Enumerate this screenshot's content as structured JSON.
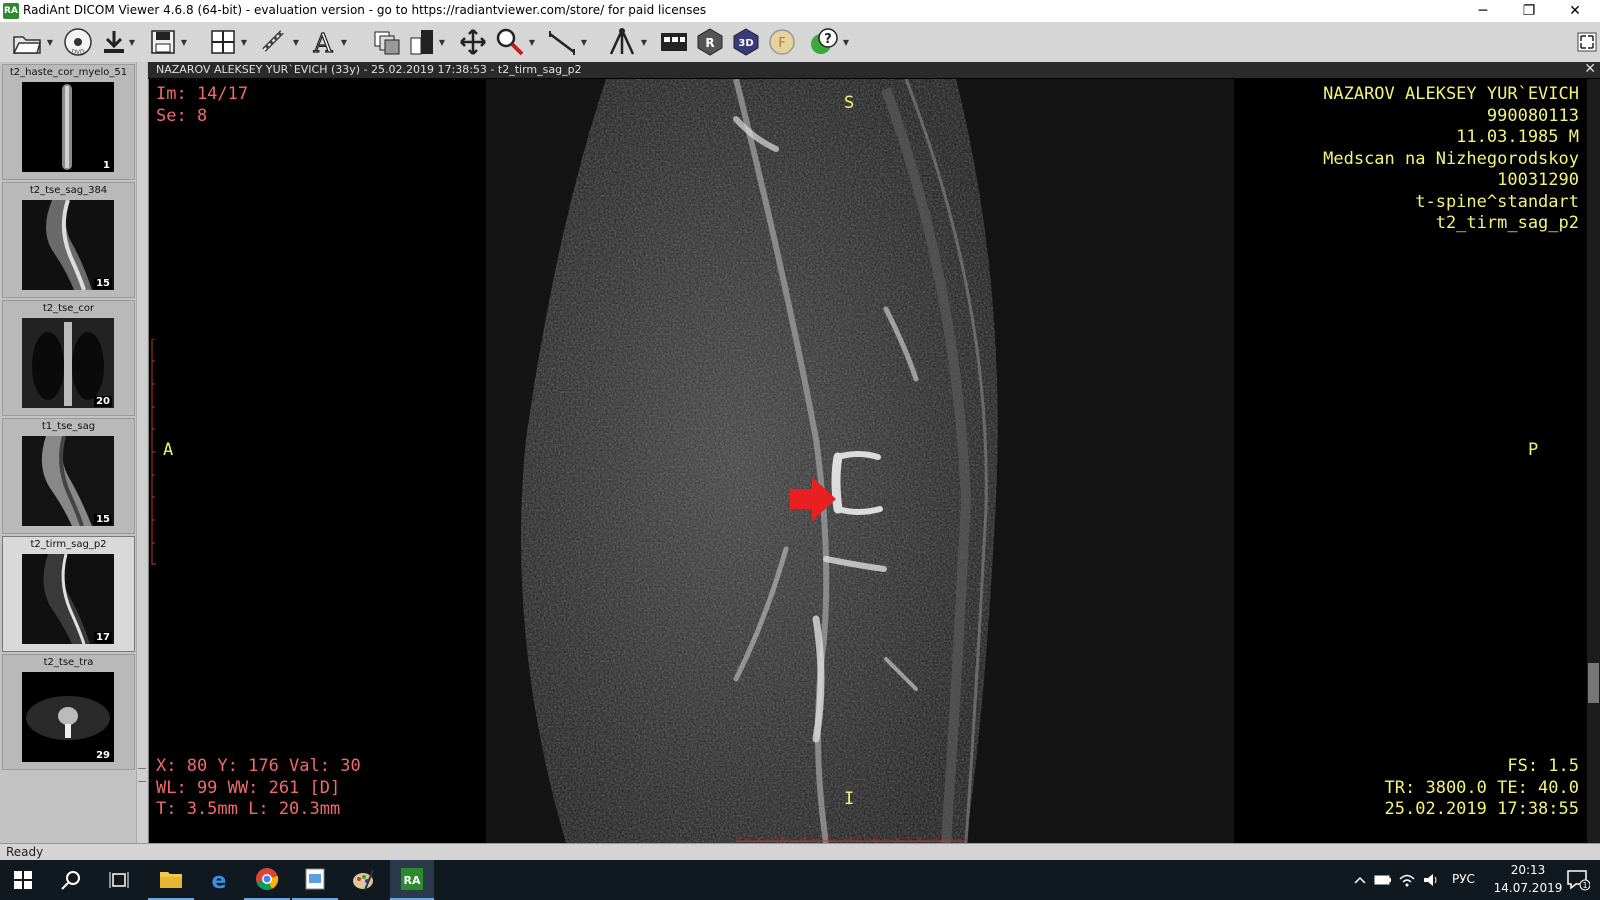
{
  "window": {
    "title": "RadiAnt DICOM Viewer 4.6.8 (64-bit) - evaluation version - go to https://radiantviewer.com/store/ for paid licenses",
    "logo_text": "RA",
    "minimize": "─",
    "restore": "❐",
    "close": "✕"
  },
  "toolbar": {
    "icons": [
      "open-folder-icon",
      "dvd-icon",
      "download-icon",
      "save-icon",
      "layout-grid-icon",
      "link-icon",
      "annotation-text-icon",
      "series-stack-icon",
      "window-level-icon",
      "pan-icon",
      "zoom-icon",
      "ruler-icon",
      "mpr-axes-icon",
      "cine-icon",
      "mpr-icon",
      "3d-icon",
      "fusion-icon",
      "help-icon"
    ],
    "label_3d": "3D",
    "label_mr": "R",
    "label_f": "F"
  },
  "series": [
    {
      "title": "t2_haste_cor_myelo_51",
      "count": "1"
    },
    {
      "title": "t2_tse_sag_384",
      "count": "15"
    },
    {
      "title": "t2_tse_cor",
      "count": "20"
    },
    {
      "title": "t1_tse_sag",
      "count": "15"
    },
    {
      "title": "t2_tirm_sag_p2",
      "count": "17"
    },
    {
      "title": "t2_tse_tra",
      "count": "29"
    }
  ],
  "viewer": {
    "header": "NAZAROV ALEKSEY YUR`EVICH (33y) - 25.02.2019 17:38:53 - t2_tirm_sag_p2",
    "close": "✕",
    "top_left": {
      "image": "Im: 14/17",
      "series": "Se: 8"
    },
    "top_right": {
      "patient_name": "NAZAROV ALEKSEY YUR`EVICH",
      "patient_id": "990080113",
      "birth": "11.03.1985 M",
      "institution": "Medscan na Nizhegorodskoy",
      "accession": "10031290",
      "study": "t-spine^standart",
      "series": "t2_tirm_sag_p2"
    },
    "bottom_left": {
      "cursor": "X: 80 Y: 176 Val: 30",
      "window": "WL: 99 WW: 261 [D]",
      "thickness": "T: 3.5mm L: 20.3mm"
    },
    "bottom_right": {
      "fs": "FS: 1.5",
      "tr_te": "TR: 3800.0 TE: 40.0",
      "datetime": "25.02.2019 17:38:55"
    },
    "orientation": {
      "top": "S",
      "bottom": "I",
      "left": "A",
      "right": "P"
    }
  },
  "status": {
    "text": "Ready"
  },
  "taskbar": {
    "apps": [
      "windows-start-icon",
      "search-icon",
      "task-view-icon",
      "file-explorer-icon",
      "edge-icon",
      "chrome-icon",
      "image-viewer-icon",
      "paint-icon",
      "radiant-icon"
    ],
    "radiant_label": "RA",
    "lang": "РУС",
    "time": "20:13",
    "date": "14.07.2019",
    "notif_count": "1"
  },
  "colors": {
    "overlay_left": "#f06a6a",
    "overlay_right": "#f3f37a",
    "arrow": "#e82020"
  }
}
